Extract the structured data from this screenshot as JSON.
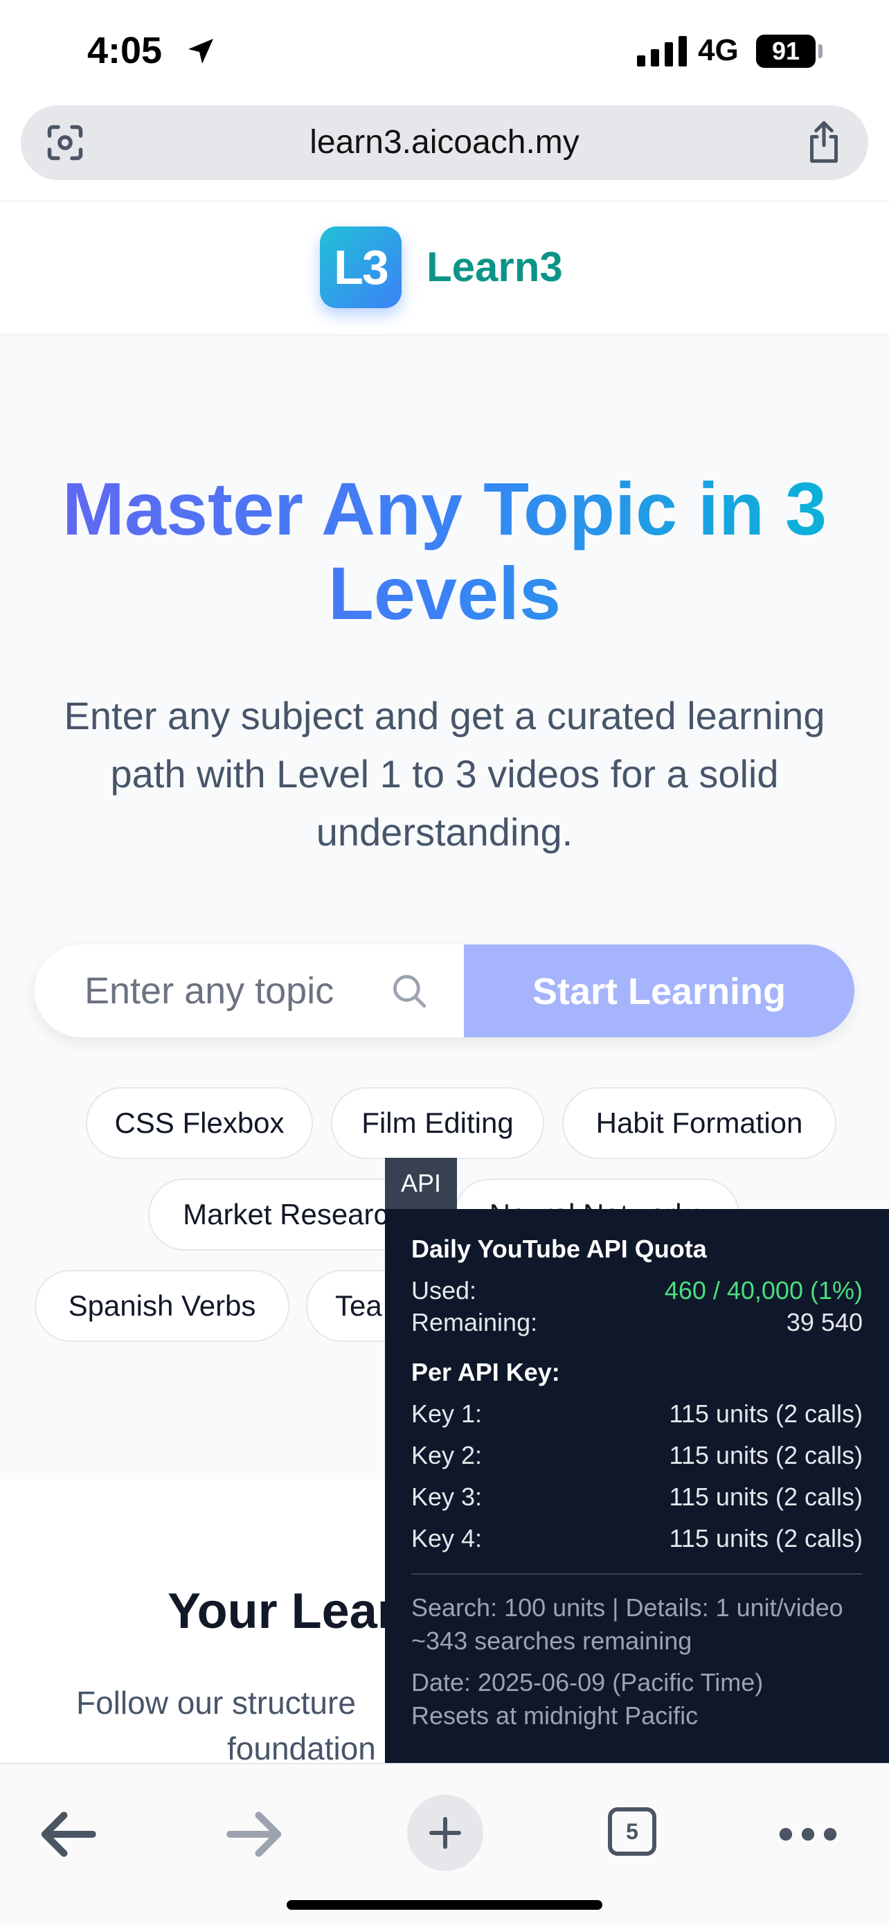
{
  "status": {
    "time": "4:05",
    "network": "4G",
    "battery": "91"
  },
  "browser": {
    "url": "learn3.aicoach.my",
    "tab_count": "5"
  },
  "header": {
    "logo_mark": "L3",
    "brand": "Learn3"
  },
  "hero": {
    "title": "Master Any Topic in 3 Levels",
    "subtitle": "Enter any subject and get a curated learning path with Level 1 to 3 videos for a solid understanding.",
    "search_placeholder": "Enter any topic",
    "start_button": "Start Learning"
  },
  "chips": [
    "CSS Flexbox",
    "Film Editing",
    "Habit Formation",
    "Market Research",
    "Neural Networks",
    "Spanish Verbs",
    "Tea"
  ],
  "section": {
    "title": "Your Lear",
    "subtitle_line1": "Follow our structure",
    "subtitle_line2": "foundation"
  },
  "api": {
    "tab": "API",
    "heading": "Daily YouTube API Quota",
    "used_label": "Used:",
    "used_value": "460 / 40,000 (1%)",
    "remaining_label": "Remaining:",
    "remaining_value": "39 540",
    "per_key_heading": "Per API Key:",
    "keys": [
      {
        "label": "Key 1:",
        "value": "115 units (2 calls)"
      },
      {
        "label": "Key 2:",
        "value": "115 units (2 calls)"
      },
      {
        "label": "Key 3:",
        "value": "115 units (2 calls)"
      },
      {
        "label": "Key 4:",
        "value": "115 units (2 calls)"
      }
    ],
    "cost_note": "Search: 100 units | Details: 1 unit/video",
    "searches_remaining": "~343 searches remaining",
    "date": "Date: 2025-06-09 (Pacific Time)",
    "reset_note": "Resets at midnight Pacific"
  },
  "colors": {
    "brand_teal": "#0d9488",
    "button_indigo": "#a5b4fc",
    "quota_green": "#4ade80",
    "panel_bg": "#0f172a"
  },
  "icons": [
    "location-arrow-icon",
    "signal-icon",
    "lens-icon",
    "share-icon",
    "search-icon",
    "back-arrow-icon",
    "forward-arrow-icon",
    "plus-icon",
    "more-icon"
  ]
}
